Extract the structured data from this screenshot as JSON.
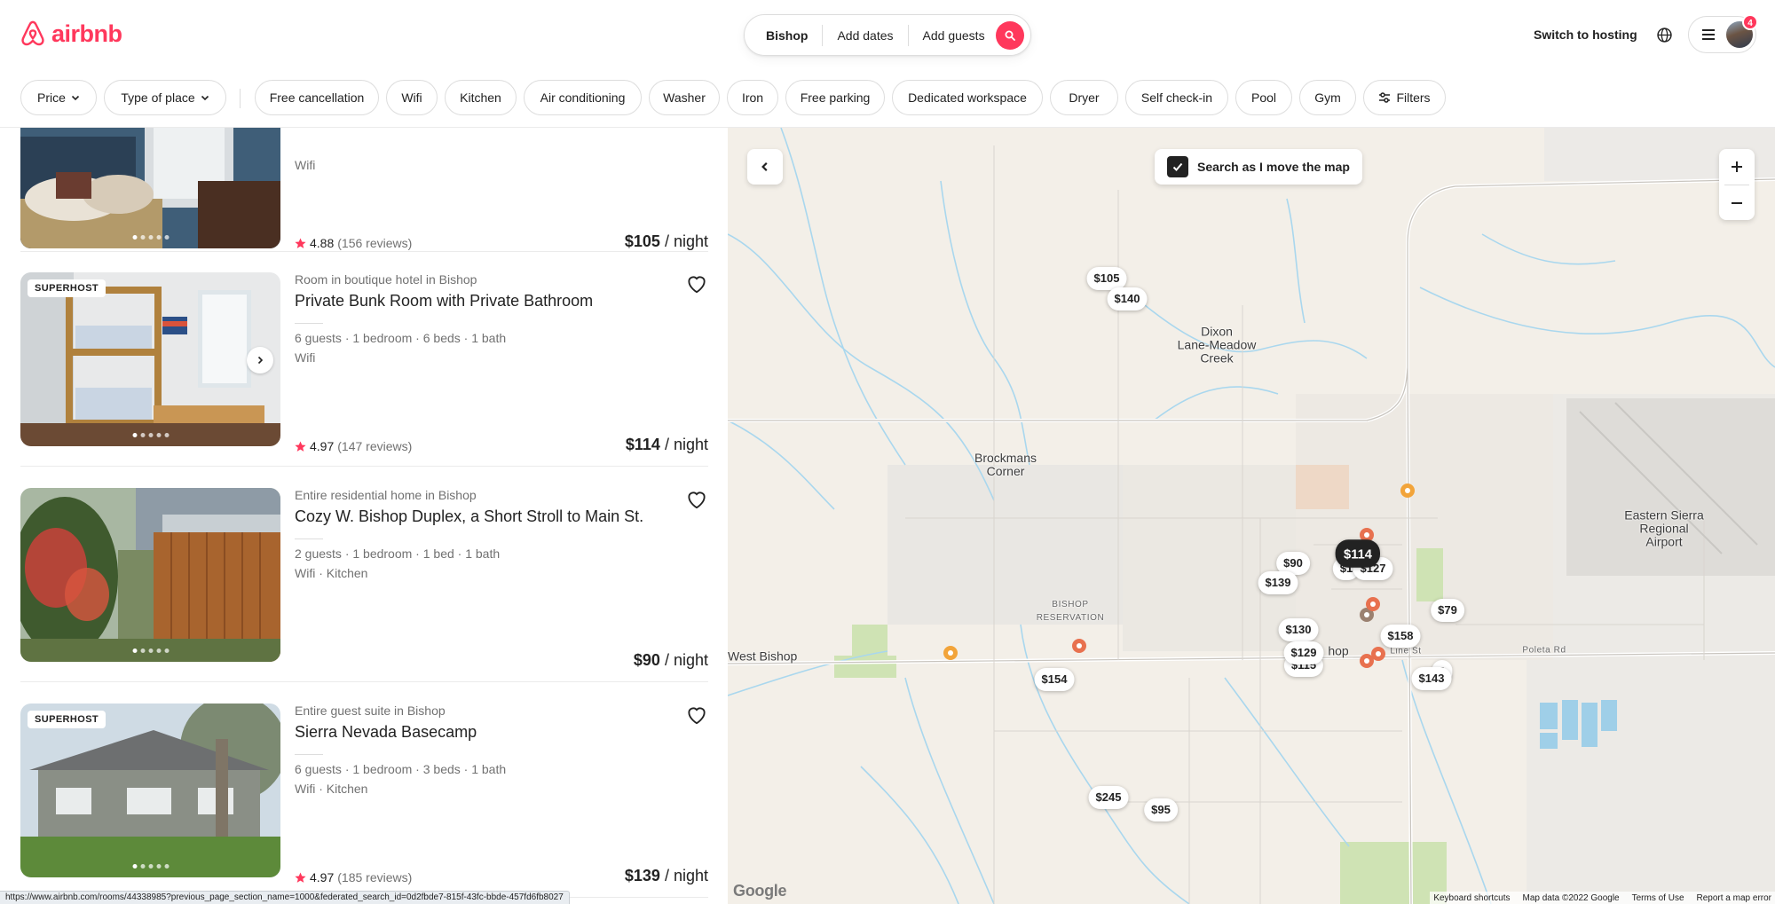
{
  "header": {
    "brand": "airbnb",
    "search": {
      "location": "Bishop",
      "dates": "Add dates",
      "guests": "Add guests"
    },
    "switch_host": "Switch to hosting",
    "notification_count": "4",
    "accent_color": "#FF385C"
  },
  "filters": [
    {
      "label": "Price",
      "icon": "chevron-down-icon"
    },
    {
      "label": "Type of place",
      "icon": "chevron-down-icon"
    },
    {
      "label": "Free cancellation"
    },
    {
      "label": "Wifi"
    },
    {
      "label": "Kitchen"
    },
    {
      "label": "Air conditioning"
    },
    {
      "label": "Washer"
    },
    {
      "label": "Iron"
    },
    {
      "label": "Free parking"
    },
    {
      "label": "Dedicated workspace"
    },
    {
      "label": "Dryer"
    },
    {
      "label": "Self check-in"
    },
    {
      "label": "Pool"
    },
    {
      "label": "Gym"
    },
    {
      "label": "Filters",
      "icon": "sliders-icon"
    }
  ],
  "listings": [
    {
      "amenities": "Wifi",
      "rating": "4.88",
      "reviews": "(156 reviews)",
      "price": "$105",
      "per": "/ night",
      "photo_dots": 5
    },
    {
      "badge": "SUPERHOST",
      "subtitle": "Room in boutique hotel in Bishop",
      "title": "Private Bunk Room with Private Bathroom",
      "specs": "6 guests · 1 bedroom · 6 beds · 1 bath",
      "amenities": "Wifi",
      "rating": "4.97",
      "reviews": "(147 reviews)",
      "price": "$114",
      "per": "/ night",
      "photo_dots": 5
    },
    {
      "subtitle": "Entire residential home in Bishop",
      "title": "Cozy W. Bishop Duplex, a Short Stroll to Main St.",
      "specs": "2 guests · 1 bedroom · 1 bed · 1 bath",
      "amenities": "Wifi · Kitchen",
      "price": "$90",
      "per": "/ night",
      "photo_dots": 5
    },
    {
      "badge": "SUPERHOST",
      "subtitle": "Entire guest suite in Bishop",
      "title": "Sierra Nevada Basecamp",
      "specs": "6 guests · 1 bedroom · 3 beds · 1 bath",
      "amenities": "Wifi · Kitchen",
      "rating": "4.97",
      "reviews": "(185 reviews)",
      "price": "$139",
      "per": "/ night",
      "photo_dots": 5
    }
  ],
  "map": {
    "search_as_move": "Search as I move the map",
    "search_as_move_checked": true,
    "place_labels": [
      {
        "id": "dixon",
        "text": "Dixon\nLane-Meadow\nCreek"
      },
      {
        "id": "brockmans",
        "text": "Brockmans\nCorner"
      },
      {
        "id": "eastern-sierra",
        "text": "Eastern Sierra\nRegional\nAirport"
      },
      {
        "id": "west-bishop",
        "text": "West Bishop"
      },
      {
        "id": "reservation",
        "text": "BISHOP\nRESERVATION"
      },
      {
        "id": "bishop",
        "text": "hop"
      },
      {
        "id": "poleta",
        "text": "Poleta Rd"
      },
      {
        "id": "line-st",
        "text": "Line St"
      }
    ],
    "price_pins": [
      {
        "label": "$105"
      },
      {
        "label": "$140"
      },
      {
        "label": "$114",
        "active": true
      },
      {
        "label": "$90"
      },
      {
        "label": "$1"
      },
      {
        "label": "$127"
      },
      {
        "label": "$139"
      },
      {
        "label": "$79"
      },
      {
        "label": "$130"
      },
      {
        "label": "$158"
      },
      {
        "label": "$129"
      },
      {
        "label": "$115"
      },
      {
        "label": "$143"
      },
      {
        "label": "0"
      },
      {
        "label": "$154"
      },
      {
        "label": "$245"
      },
      {
        "label": "$95"
      }
    ],
    "google": "Google",
    "attribution": [
      "Keyboard shortcuts",
      "Map data ©2022 Google",
      "Terms of Use",
      "Report a map error"
    ]
  },
  "status_url": "https://www.airbnb.com/rooms/44338985?previous_page_section_name=1000&federated_search_id=0d2fbde7-815f-43fc-bbde-457fd6fb8027"
}
